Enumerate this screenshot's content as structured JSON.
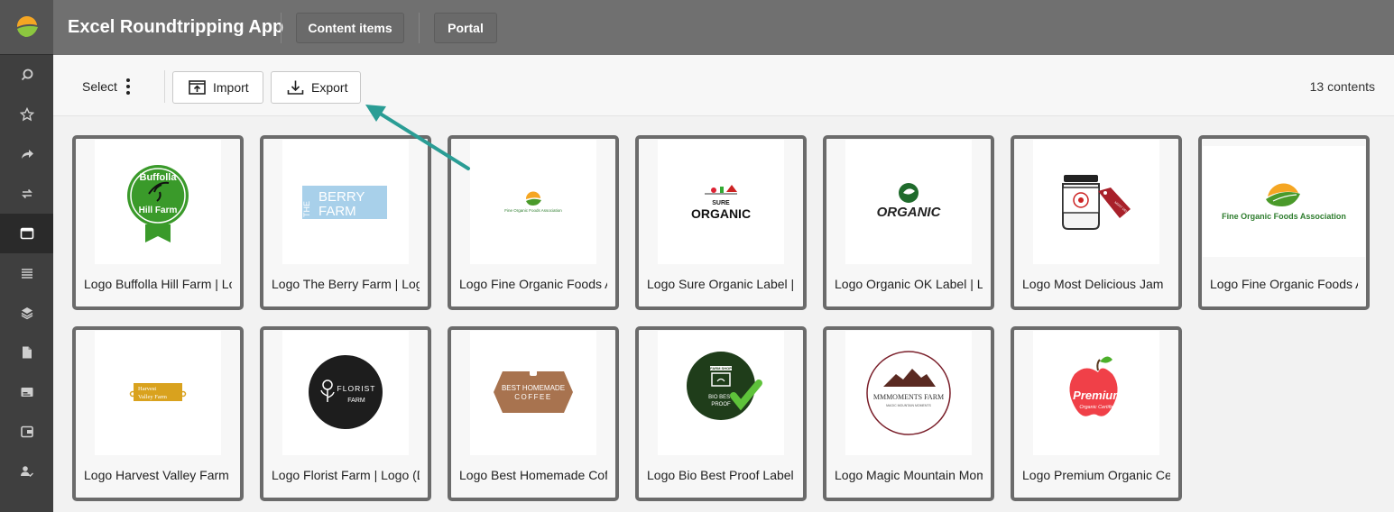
{
  "app": {
    "title": "Excel Roundtripping App",
    "tabs": [
      "Content items",
      "Portal"
    ]
  },
  "toolbar": {
    "select_label": "Select",
    "import_label": "Import",
    "export_label": "Export",
    "count_text": "13 contents"
  },
  "colors": {
    "topbar": "#707070",
    "rail": "#3f3f3f",
    "accent_arrow": "#2a9d95",
    "card_border": "#6b6b6b"
  },
  "rail_icons": [
    "app-logo-icon",
    "search-icon",
    "star-icon",
    "share-arrow-icon",
    "swap-icon",
    "window-icon",
    "list-icon",
    "layers-icon",
    "document-icon",
    "card-icon",
    "wallet-icon",
    "user-check-icon"
  ],
  "items": [
    {
      "caption": "Logo Buffolla Hill Farm | Logo",
      "logo_text": [
        "Buffolla",
        "Hill Farm"
      ]
    },
    {
      "caption": "Logo The Berry Farm | Logo",
      "logo_text": [
        "THE",
        "BERRY",
        "FARM"
      ]
    },
    {
      "caption": "Logo Fine Organic Foods Association",
      "logo_text": [
        "Fine Organic Foods Association"
      ]
    },
    {
      "caption": "Logo Sure Organic Label | Logo",
      "logo_text": [
        "SURE",
        "ORGANIC"
      ]
    },
    {
      "caption": "Logo Organic OK Label | Logo",
      "logo_text": [
        "ORGANIC"
      ]
    },
    {
      "caption": "Logo Most Delicious Jam",
      "logo_text": [
        "MOST DELICIOUS JAM"
      ]
    },
    {
      "caption": "Logo Fine Organic Foods Association",
      "logo_text": [
        "Fine Organic Foods Association"
      ]
    },
    {
      "caption": "Logo Harvest Valley Farm",
      "logo_text": [
        "Harvest",
        "Valley Farm"
      ]
    },
    {
      "caption": "Logo Florist Farm | Logo (Dark)",
      "logo_text": [
        "FLORIST",
        "FARM"
      ]
    },
    {
      "caption": "Logo Best Homemade Coffee",
      "logo_text": [
        "BEST HOMEMADE",
        "COFFEE"
      ]
    },
    {
      "caption": "Logo Bio Best Proof Label",
      "logo_text": [
        "FARM SHOP",
        "BIO BEST",
        "PROOF"
      ]
    },
    {
      "caption": "Logo Magic Mountain Moments",
      "logo_text": [
        "MMMOMENTS FARM",
        "MAGIC MOUNTAIN MOMENTS"
      ]
    },
    {
      "caption": "Logo Premium Organic Certified",
      "logo_text": [
        "Premium",
        "Organic Certified"
      ]
    }
  ]
}
